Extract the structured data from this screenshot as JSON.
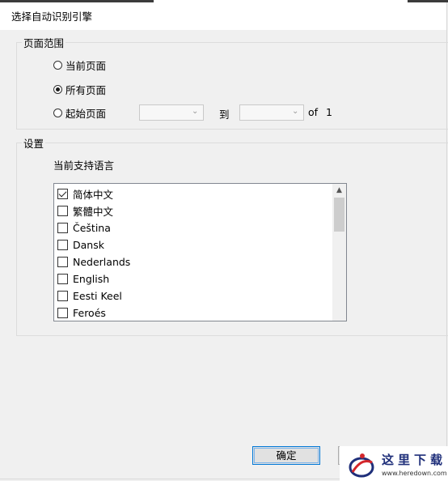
{
  "window": {
    "title": "选择自动识别引擎"
  },
  "page_range": {
    "legend": "页面范围",
    "options": [
      {
        "label": "当前页面",
        "checked": false
      },
      {
        "label": "所有页面",
        "checked": true
      },
      {
        "label": "起始页面",
        "checked": false
      }
    ],
    "from_value": "",
    "to_label": "到",
    "to_value": "",
    "of_label": "of",
    "total_pages": "1"
  },
  "settings": {
    "legend": "设置",
    "languages_label": "当前支持语言",
    "languages": [
      {
        "label": "简体中文",
        "checked": true
      },
      {
        "label": "繁體中文",
        "checked": false
      },
      {
        "label": "Čeština",
        "checked": false
      },
      {
        "label": "Dansk",
        "checked": false
      },
      {
        "label": "Nederlands",
        "checked": false
      },
      {
        "label": "English",
        "checked": false
      },
      {
        "label": "Eesti Keel",
        "checked": false
      },
      {
        "label": "Feroés",
        "checked": false
      }
    ]
  },
  "buttons": {
    "ok_label": "确定"
  },
  "watermark": {
    "cn": "这里下载",
    "url": "www.heredown.com"
  }
}
